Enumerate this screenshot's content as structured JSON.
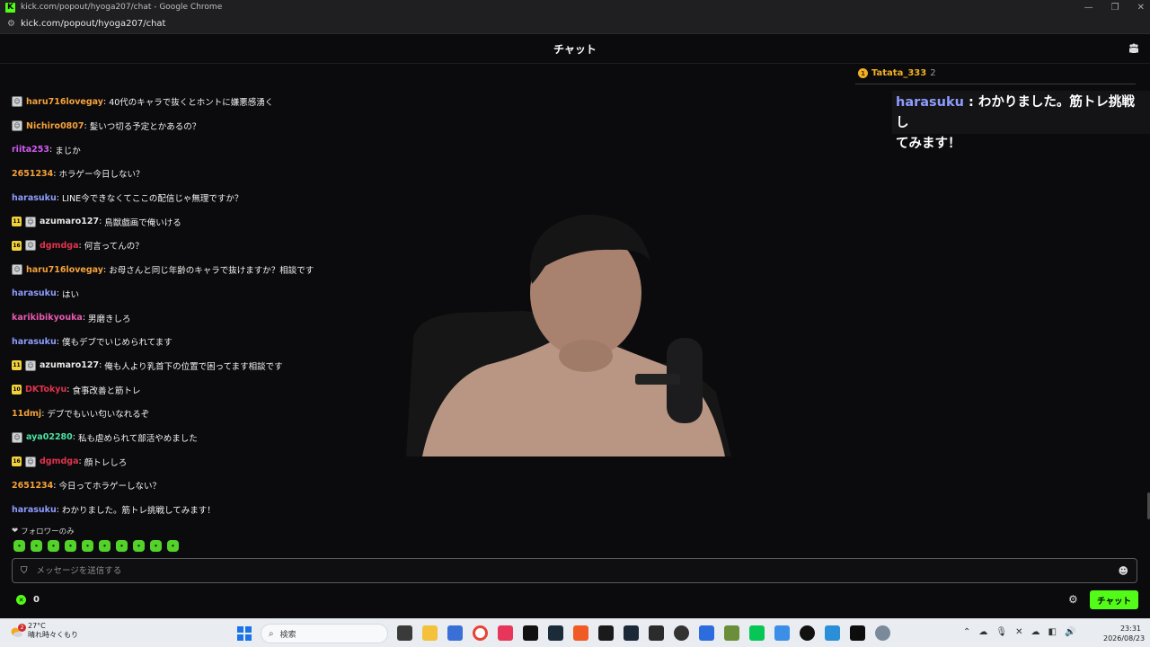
{
  "window": {
    "title": "kick.com/popout/hyoga207/chat - Google Chrome",
    "url": "kick.com/popout/hyoga207/chat"
  },
  "header": {
    "title": "チャット"
  },
  "pinned": {
    "gifter": "Tatata_333",
    "count": "2",
    "coin_label": "1"
  },
  "messages": [
    {
      "user": "haru716lovegay",
      "color": "#f6a23a",
      "avatar": true,
      "sub": "",
      "text": "40代のキャラで抜くとホントに嫌悪感湧く"
    },
    {
      "user": "Nichiro0807",
      "color": "#f6a23a",
      "avatar": true,
      "sub": "",
      "text": "髪いつ切る予定とかあるの？"
    },
    {
      "user": "riita253",
      "color": "#d25bf2",
      "avatar": false,
      "sub": "",
      "text": "まじか"
    },
    {
      "user": "2651234",
      "color": "#f6a23a",
      "avatar": false,
      "sub": "",
      "text": "ホラゲー今日しない？"
    },
    {
      "user": "harasuku",
      "color": "#8d9cff",
      "avatar": false,
      "sub": "",
      "text": "LINE今できなくてここの配信じゃ無理ですか？"
    },
    {
      "user": "azumaro127",
      "color": "#e8e8e8",
      "avatar": true,
      "sub": "11",
      "text": "鳥獣戯画で俺いける"
    },
    {
      "user": "dgmdga",
      "color": "#e0334c",
      "avatar": true,
      "sub": "16",
      "text": "何言ってんの？"
    },
    {
      "user": "haru716lovegay",
      "color": "#f6a23a",
      "avatar": true,
      "sub": "",
      "text": "お母さんと同じ年齢のキャラで抜けますか？相談です"
    },
    {
      "user": "harasuku",
      "color": "#8d9cff",
      "avatar": false,
      "sub": "",
      "text": "はい"
    },
    {
      "user": "karikibikyouka",
      "color": "#e85ab0",
      "avatar": false,
      "sub": "",
      "text": "男磨きしろ"
    },
    {
      "user": "harasuku",
      "color": "#8d9cff",
      "avatar": false,
      "sub": "",
      "text": "僕もデブでいじめられてます"
    },
    {
      "user": "azumaro127",
      "color": "#e8e8e8",
      "avatar": true,
      "sub": "11",
      "text": "俺も人より乳首下の位置で困ってます相談です"
    },
    {
      "user": "DKTokyu",
      "color": "#e0334c",
      "avatar": false,
      "sub": "10",
      "text": "食事改善と筋トレ"
    },
    {
      "user": "11dmj",
      "color": "#f6a23a",
      "avatar": false,
      "sub": "",
      "text": "デブでもいい匂いなれるぞ"
    },
    {
      "user": "aya02280",
      "color": "#4be0a0",
      "avatar": true,
      "sub": "",
      "text": "私も虐められて部活やめました"
    },
    {
      "user": "dgmdga",
      "color": "#e0334c",
      "avatar": true,
      "sub": "16",
      "text": "顔トレしろ"
    },
    {
      "user": "2651234",
      "color": "#f6a23a",
      "avatar": false,
      "sub": "",
      "text": "今日ってホラゲーしない？"
    },
    {
      "user": "harasuku",
      "color": "#8d9cff",
      "avatar": false,
      "sub": "",
      "text": "わかりました。筋トレ挑戦してみます！"
    }
  ],
  "overlay": {
    "user": "harasuku",
    "line1_text": "わかりました。筋トレ挑戦し",
    "line2_text": "てみます！"
  },
  "follower_only": "フォロワーのみ",
  "input": {
    "placeholder": "メッセージを送信する",
    "value": ""
  },
  "bottom": {
    "kick_count": "0",
    "chat_button": "チャット"
  },
  "taskbar": {
    "weather_temp": "27°C",
    "weather_desc": "晴れ時々くもり",
    "weather_badge": "2",
    "search_placeholder": "検索",
    "time": "23:31",
    "date": "2026/08/23"
  },
  "colors": {
    "accent": "#53fc18",
    "background": "#0b0b0d"
  }
}
